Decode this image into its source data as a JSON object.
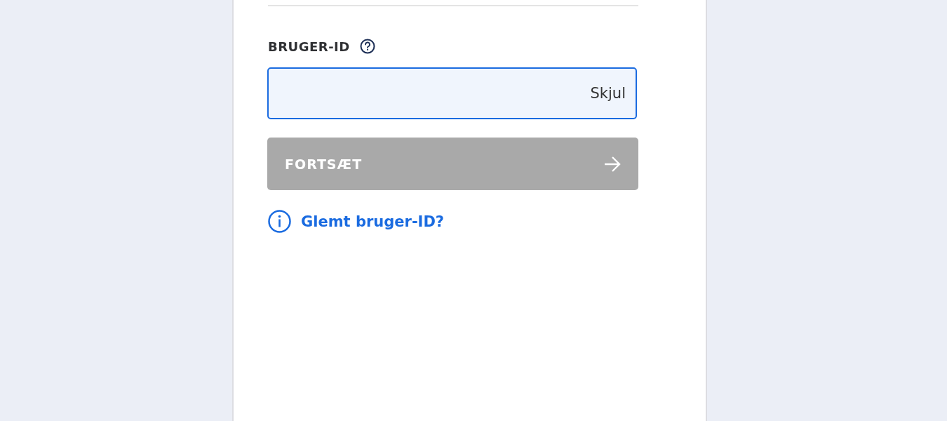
{
  "login": {
    "field_label": "BRUGER-ID",
    "field": {
      "focused": true,
      "toggle": "Skjul"
    },
    "continue_button": {
      "label": "FORTSÆT",
      "disabled": true
    },
    "help_link": "Glemt bruger-ID?"
  }
}
